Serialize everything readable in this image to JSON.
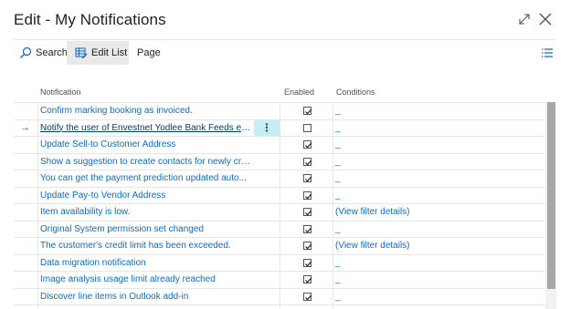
{
  "window": {
    "title": "Edit - My Notifications",
    "expand_icon": "expand-icon",
    "close_icon": "close-icon"
  },
  "toolbar": {
    "search_label": "Search",
    "edit_list_label": "Edit List",
    "page_label": "Page",
    "menu_icon": "list-menu-icon"
  },
  "colors": {
    "link": "#0e6bbd",
    "selected_action_bg": "#c6eef5",
    "scroll_thumb": "#a7a7a7"
  },
  "table": {
    "columns": [
      "Notification",
      "Enabled",
      "Conditions"
    ],
    "rows": [
      {
        "notification": "Confirm marking booking as invoiced.",
        "enabled": true,
        "conditions": "_"
      },
      {
        "notification": "Notify the user of Envestnet Yodlee Bank Feeds ext...",
        "enabled": false,
        "conditions": "_",
        "selected": true
      },
      {
        "notification": "Update Sell-to Customer Address",
        "enabled": true,
        "conditions": "_"
      },
      {
        "notification": "Show a suggestion to create contacts for newly cre...",
        "enabled": true,
        "conditions": "_"
      },
      {
        "notification": "You can get the payment prediction updated auto...",
        "enabled": true,
        "conditions": "_"
      },
      {
        "notification": "Update Pay-to Vendor Address",
        "enabled": true,
        "conditions": "_"
      },
      {
        "notification": "Item availability is low.",
        "enabled": true,
        "conditions": "(View filter details)"
      },
      {
        "notification": "Original System permission set changed",
        "enabled": true,
        "conditions": "_"
      },
      {
        "notification": "The customer's credit limit has been exceeded.",
        "enabled": true,
        "conditions": "(View filter details)"
      },
      {
        "notification": "Data migration notification",
        "enabled": true,
        "conditions": "_"
      },
      {
        "notification": "Image analysis usage limit already reached",
        "enabled": true,
        "conditions": "_"
      },
      {
        "notification": "Discover line items in Outlook add-in",
        "enabled": true,
        "conditions": "_"
      },
      {
        "notification": "",
        "enabled": true,
        "conditions": ""
      }
    ]
  }
}
